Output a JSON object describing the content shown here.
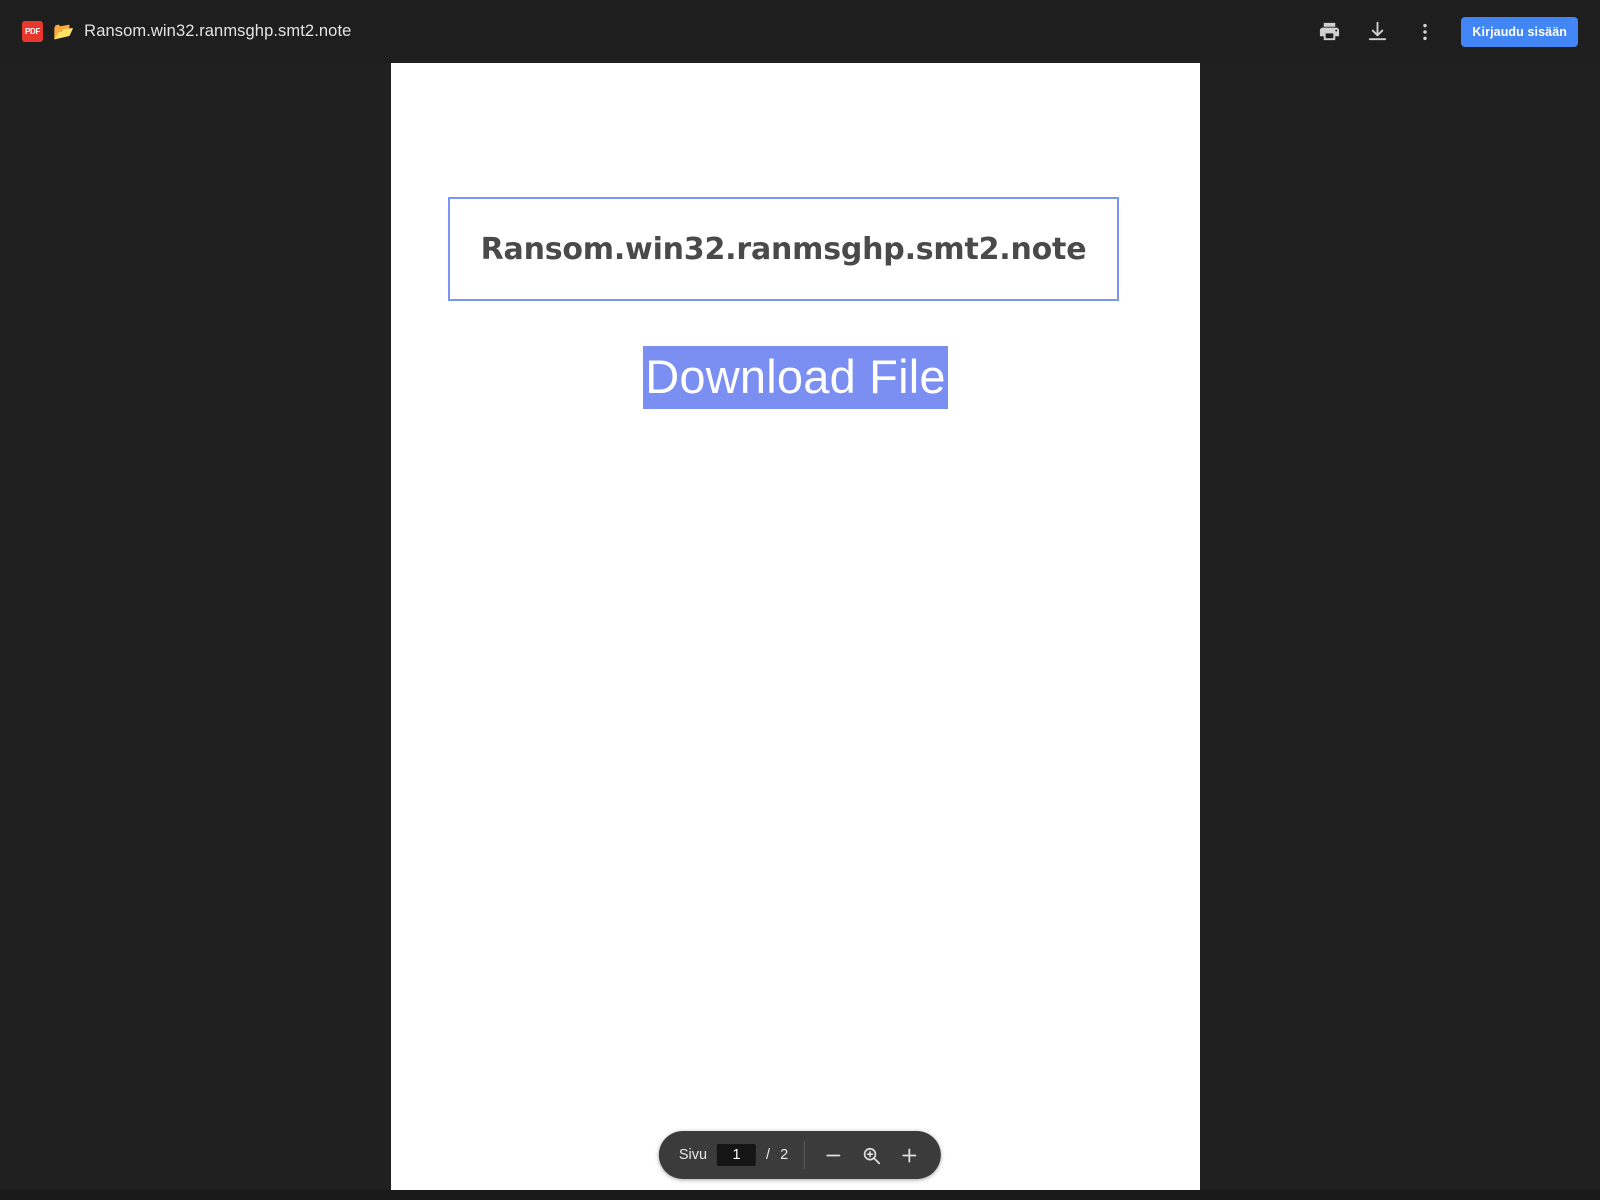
{
  "window": {
    "background_color": "#1e1e1e",
    "viewer_background_color": "#202020"
  },
  "topbar": {
    "file_type_badge": "PDF",
    "file_type_icon": "pdf-file-icon",
    "folder_icon": "open-folder-icon",
    "folder_glyph": "📂",
    "document_title": "Ransom.win32.ranmsghp.smt2.note",
    "actions": [
      {
        "name": "print-button",
        "icon": "printer-icon"
      },
      {
        "name": "download-button",
        "icon": "download-icon"
      },
      {
        "name": "more-options-button",
        "icon": "kebab-menu-icon"
      }
    ],
    "signin_label": "Kirjaudu sisään",
    "signin_color": "#4285f4"
  },
  "page": {
    "heading": "Ransom.win32.ranmsghp.smt2.note",
    "heading_border_color": "#7b95f5",
    "download_link_text": "Download File",
    "download_selection_color": "#7b8ff2",
    "download_selection_text_color": "#ffffff"
  },
  "bottom_toolbar": {
    "page_label": "Sivu",
    "current_page": "1",
    "page_separator": "/",
    "total_pages": "2",
    "zoom_out_icon": "minus-icon",
    "zoom_level_icon": "magnifier-zoom-icon",
    "zoom_in_icon": "plus-icon",
    "background_color": "#3b3b3b"
  }
}
